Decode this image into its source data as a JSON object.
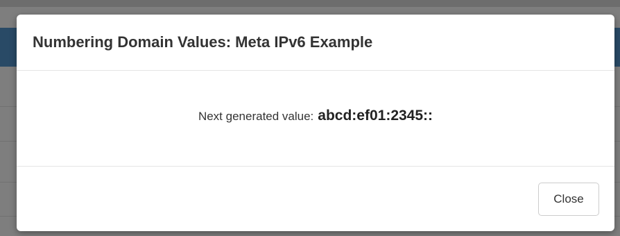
{
  "modal": {
    "title": "Numbering Domain Values: Meta IPv6 Example",
    "body": {
      "label": "Next generated value:",
      "value": "abcd:ef01:2345::"
    },
    "footer": {
      "close_label": "Close"
    }
  },
  "colors": {
    "backdrop": "#7e7e7e",
    "navbar": "#294a66",
    "modal_background": "#ffffff",
    "text": "#333333",
    "divider": "#e5e5e5",
    "button_border": "#cccccc"
  }
}
